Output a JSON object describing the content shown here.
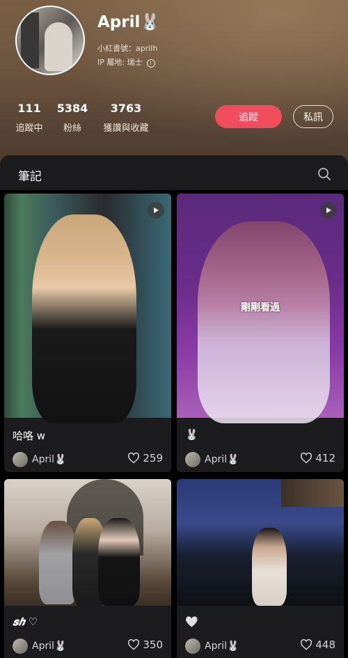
{
  "profile": {
    "name": "April🐰",
    "id_line": "小紅書號：aprilh",
    "ip_line": "IP 屬地: 瑞士",
    "stats": [
      {
        "value": "111",
        "label": "追蹤中"
      },
      {
        "value": "5384",
        "label": "粉絲"
      },
      {
        "value": "3763",
        "label": "獲讚與收藏"
      }
    ],
    "follow_label": "追蹤",
    "message_label": "私訊"
  },
  "notes": {
    "header": "筆記",
    "cards": [
      {
        "title": "哈咯 w",
        "author": "April🐰",
        "likes": "259",
        "video": true,
        "recent": ""
      },
      {
        "title": "🐰",
        "author": "April🐰",
        "likes": "412",
        "video": true,
        "recent": "剛剛看過"
      },
      {
        "title": "𝒔𝒉 ♡",
        "author": "April🐰",
        "likes": "350",
        "video": false,
        "recent": ""
      },
      {
        "title": "🤍",
        "author": "April🐰",
        "likes": "448",
        "video": false,
        "recent": ""
      }
    ]
  },
  "colors": {
    "accent": "#f24d5e",
    "card_bg": "#1c1c1e"
  }
}
